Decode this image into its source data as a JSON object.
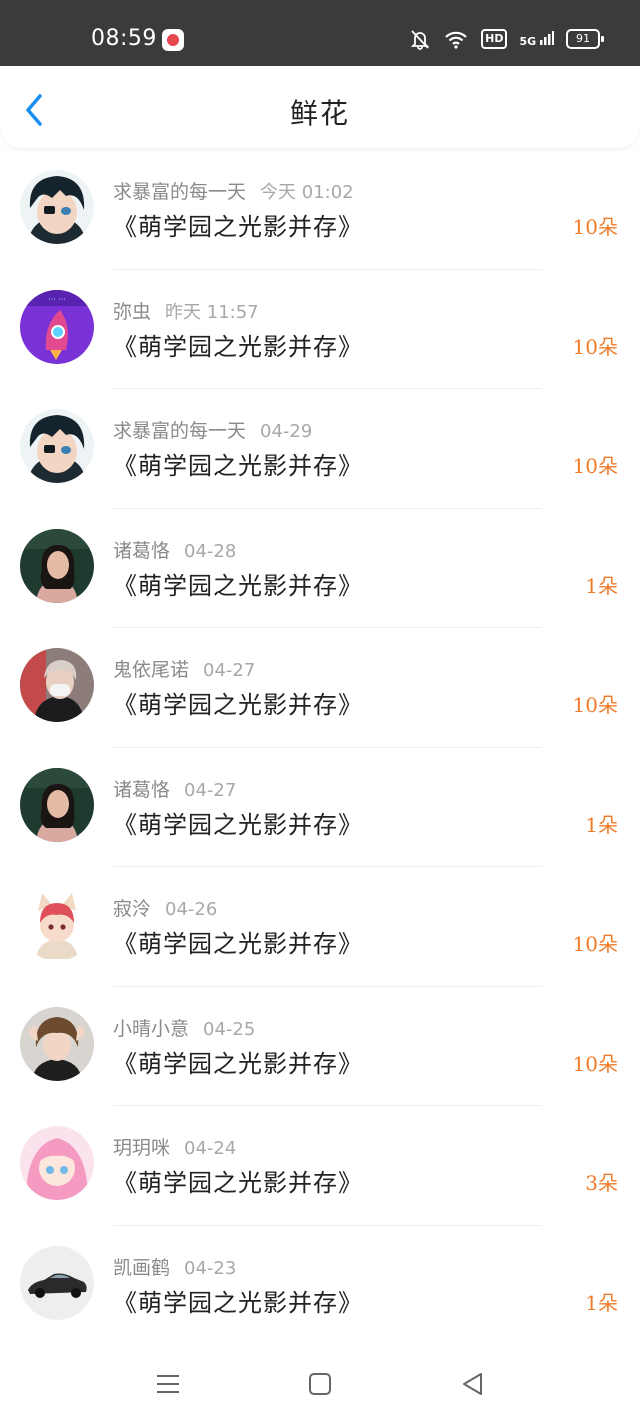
{
  "status_bar": {
    "time": "08:59",
    "app_icon": "notification-app-icon",
    "icons": [
      "mute-bell-icon",
      "wifi-icon",
      "hd-icon",
      "5g-signal-icon",
      "battery-icon"
    ],
    "hd": "HD",
    "network": "5G",
    "battery": "91"
  },
  "header": {
    "title": "鲜花",
    "back_icon": "chevron-left-icon",
    "accent": "#1a8ef0"
  },
  "colors": {
    "count": "#f07c2b"
  },
  "list": [
    {
      "name": "求暴富的每一天",
      "time": "今天 01:02",
      "book": "《萌学园之光影并存》",
      "count": "10朵",
      "avatar": "anime-boy-eyepatch"
    },
    {
      "name": "弥虫",
      "time": "昨天 11:57",
      "book": "《萌学园之光影并存》",
      "count": "10朵",
      "avatar": "purple-rocket"
    },
    {
      "name": "求暴富的每一天",
      "time": "04-29",
      "book": "《萌学园之光影并存》",
      "count": "10朵",
      "avatar": "anime-boy-eyepatch"
    },
    {
      "name": "诸葛恪",
      "time": "04-28",
      "book": "《萌学园之光影并存》",
      "count": "1朵",
      "avatar": "woman-photo"
    },
    {
      "name": "鬼依尾诺",
      "time": "04-27",
      "book": "《萌学园之光影并存》",
      "count": "10朵",
      "avatar": "masked-person-photo"
    },
    {
      "name": "诸葛恪",
      "time": "04-27",
      "book": "《萌学园之光影并存》",
      "count": "1朵",
      "avatar": "woman-photo"
    },
    {
      "name": "寂泠",
      "time": "04-26",
      "book": "《萌学园之光影并存》",
      "count": "10朵",
      "avatar": "cat-ear-anime"
    },
    {
      "name": "小晴小意",
      "time": "04-25",
      "book": "《萌学园之光影并存》",
      "count": "10朵",
      "avatar": "brown-hair-person"
    },
    {
      "name": "玥玥咪",
      "time": "04-24",
      "book": "《萌学园之光影并存》",
      "count": "3朵",
      "avatar": "pink-anime-girl"
    },
    {
      "name": "凯画鹤",
      "time": "04-23",
      "book": "《萌学园之光影并存》",
      "count": "1朵",
      "avatar": "sports-car"
    }
  ],
  "nav_bar": {
    "icons": [
      "menu-icon",
      "home-square-icon",
      "back-triangle-icon"
    ]
  }
}
